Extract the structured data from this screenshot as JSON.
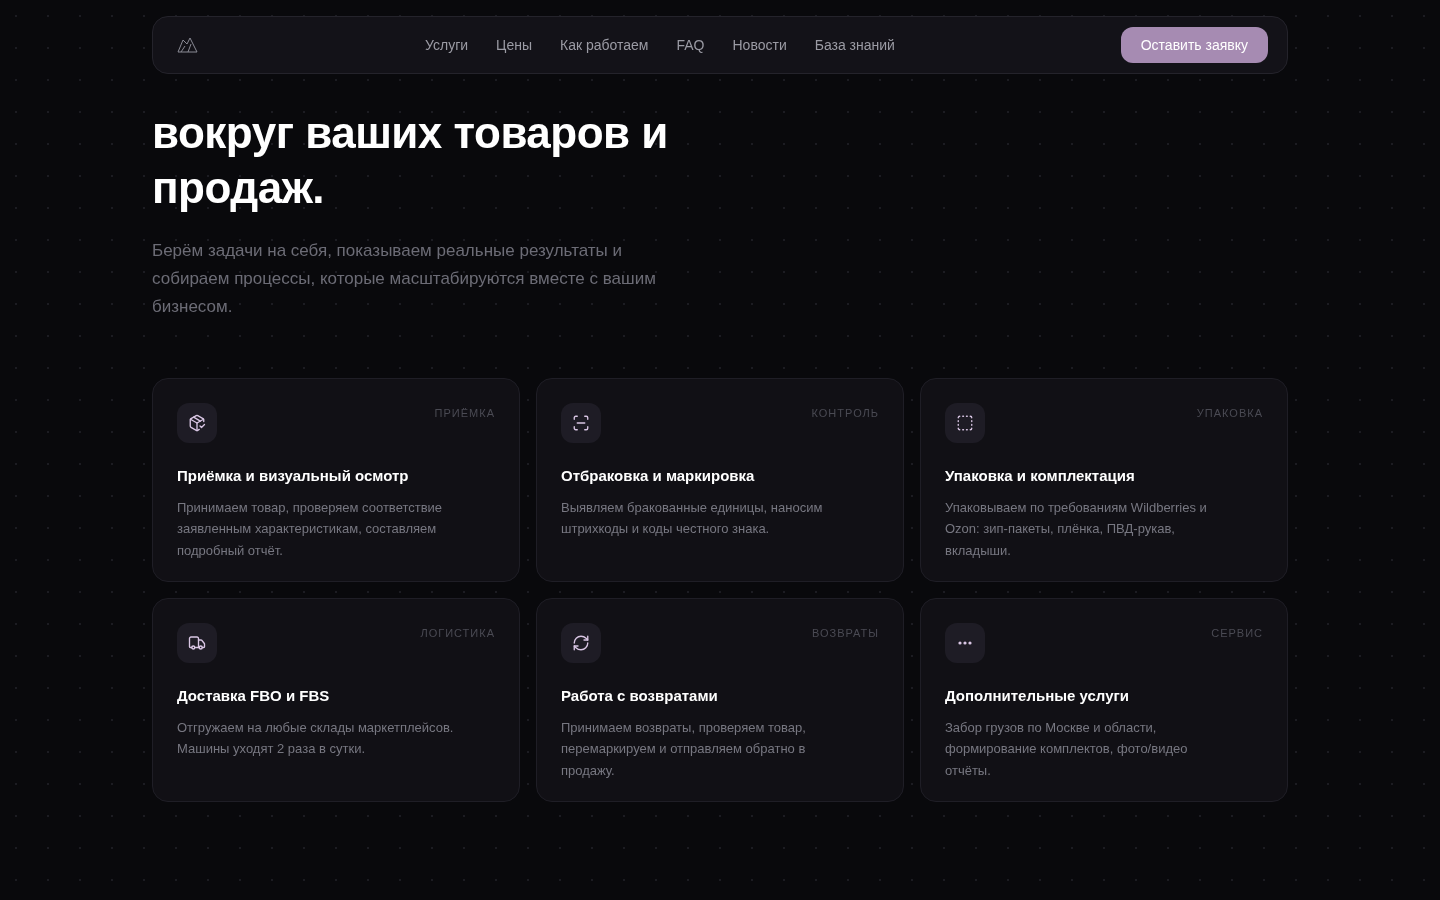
{
  "nav": {
    "links": [
      "Услуги",
      "Цены",
      "Как работаем",
      "FAQ",
      "Новости",
      "База знаний"
    ],
    "cta": "Оставить заявку"
  },
  "hero": {
    "title": "вокруг ваших товаров и продаж.",
    "subtitle": "Берём задачи на себя, показываем реальные результаты и собираем процессы, которые масштабируются вместе с вашим бизнесом."
  },
  "services": [
    {
      "tag": "ПРИЁМКА",
      "title": "Приёмка и визуальный осмотр",
      "text": "Принимаем товар, проверяем соответствие заявленным характеристикам, составляем подробный отчёт."
    },
    {
      "tag": "КОНТРОЛЬ",
      "title": "Отбраковка и маркировка",
      "text": "Выявляем бракованные единицы, наносим штрихкоды и коды честного знака."
    },
    {
      "tag": "УПАКОВКА",
      "title": "Упаковка и комплектация",
      "text": "Упаковываем по требованиям Wildberries и Ozon: зип-пакеты, плёнка, ПВД-рукав, вкладыши."
    },
    {
      "tag": "ЛОГИСТИКА",
      "title": "Доставка FBO и FBS",
      "text": "Отгружаем на любые склады маркетплейсов. Машины уходят 2 раза в сутки."
    },
    {
      "tag": "ВОЗВРАТЫ",
      "title": "Работа с возвратами",
      "text": "Принимаем возвраты, проверяем товар, перемаркируем и отправляем обратно в продажу."
    },
    {
      "tag": "СЕРВИС",
      "title": "Дополнительные услуги",
      "text": "Забор грузов по Москве и области, формирование комплектов, фото/видео отчёты."
    }
  ]
}
